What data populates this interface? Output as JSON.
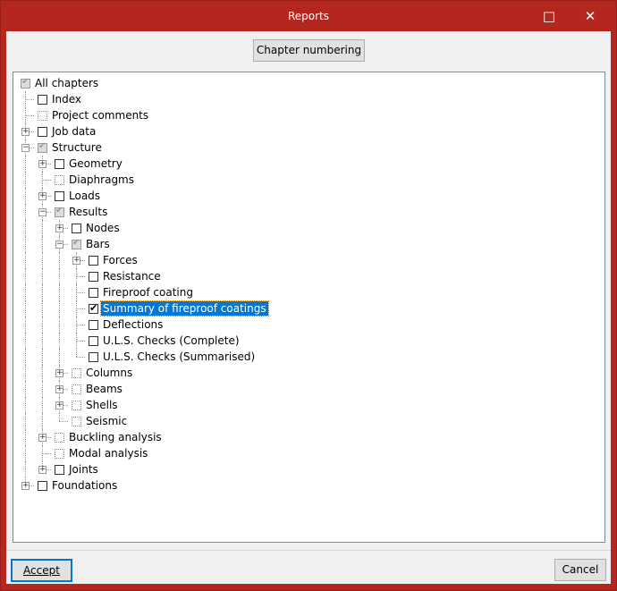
{
  "window": {
    "title": "Reports",
    "minimize_icon": "□",
    "close_icon": "✕"
  },
  "toolbar": {
    "chapter_numbering": "Chapter numbering"
  },
  "tree": [
    {
      "label": "All chapters",
      "level": 0,
      "state": "partial",
      "exp": ""
    },
    {
      "label": "Index",
      "level": 1,
      "state": "unchecked",
      "exp": ""
    },
    {
      "label": "Project comments",
      "level": 1,
      "state": "dotted",
      "exp": ""
    },
    {
      "label": "Job data",
      "level": 1,
      "state": "unchecked",
      "exp": "+"
    },
    {
      "label": "Structure",
      "level": 1,
      "state": "partial",
      "exp": "-"
    },
    {
      "label": "Geometry",
      "level": 2,
      "state": "unchecked",
      "exp": "+"
    },
    {
      "label": "Diaphragms",
      "level": 2,
      "state": "dotted",
      "exp": ""
    },
    {
      "label": "Loads",
      "level": 2,
      "state": "unchecked",
      "exp": "+"
    },
    {
      "label": "Results",
      "level": 2,
      "state": "partial",
      "exp": "-"
    },
    {
      "label": "Nodes",
      "level": 3,
      "state": "unchecked",
      "exp": "+"
    },
    {
      "label": "Bars",
      "level": 3,
      "state": "partial",
      "exp": "-"
    },
    {
      "label": "Forces",
      "level": 4,
      "state": "unchecked",
      "exp": "+"
    },
    {
      "label": "Resistance",
      "level": 4,
      "state": "unchecked",
      "exp": ""
    },
    {
      "label": "Fireproof coating",
      "level": 4,
      "state": "unchecked",
      "exp": ""
    },
    {
      "label": "Summary of fireproof coatings",
      "level": 4,
      "state": "checked",
      "exp": "",
      "selected": true
    },
    {
      "label": "Deflections",
      "level": 4,
      "state": "unchecked",
      "exp": ""
    },
    {
      "label": "U.L.S. Checks (Complete)",
      "level": 4,
      "state": "unchecked",
      "exp": ""
    },
    {
      "label": "U.L.S. Checks (Summarised)",
      "level": 4,
      "state": "unchecked",
      "exp": ""
    },
    {
      "label": "Columns",
      "level": 3,
      "state": "dotted",
      "exp": "+"
    },
    {
      "label": "Beams",
      "level": 3,
      "state": "dotted",
      "exp": "+"
    },
    {
      "label": "Shells",
      "level": 3,
      "state": "dotted",
      "exp": "+"
    },
    {
      "label": "Seismic",
      "level": 3,
      "state": "dotted",
      "exp": ""
    },
    {
      "label": "Buckling analysis",
      "level": 2,
      "state": "dotted",
      "exp": "+"
    },
    {
      "label": "Modal analysis",
      "level": 2,
      "state": "dotted",
      "exp": ""
    },
    {
      "label": "Joints",
      "level": 2,
      "state": "unchecked",
      "exp": "+"
    },
    {
      "label": "Foundations",
      "level": 1,
      "state": "unchecked",
      "exp": "+"
    }
  ],
  "footer": {
    "accept": "Accept",
    "cancel": "Cancel"
  }
}
